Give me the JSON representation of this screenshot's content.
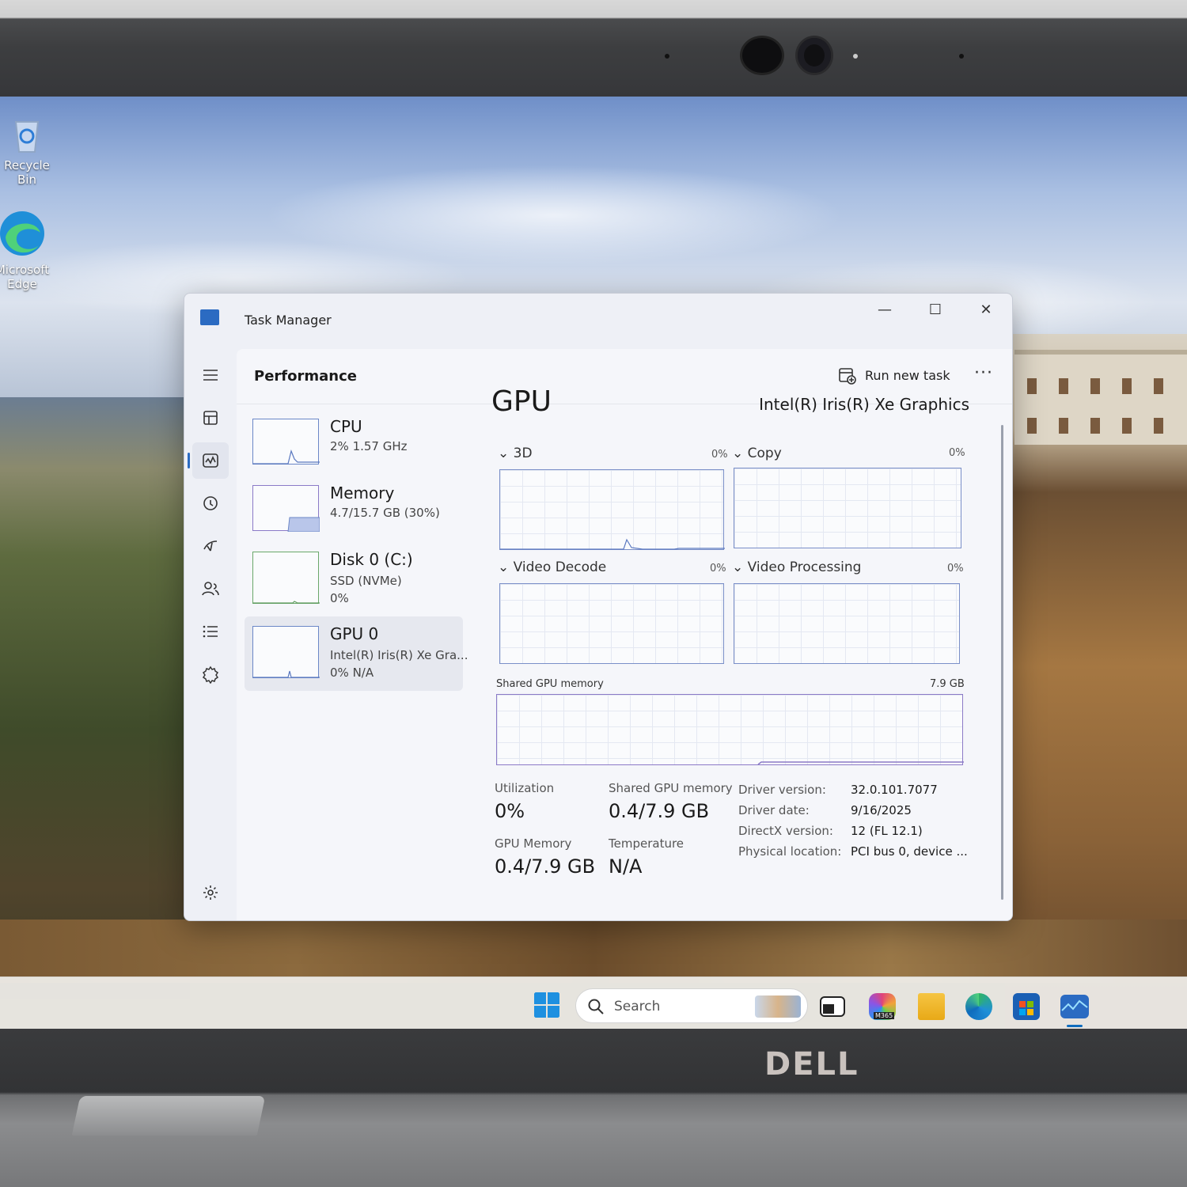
{
  "desktop": {
    "icons": [
      {
        "label": "Recycle Bin",
        "icon": "recycle-bin-icon"
      },
      {
        "label": "Microsoft Edge",
        "icon": "edge-icon"
      }
    ]
  },
  "bezel": {
    "brand": "DELL"
  },
  "taskbar": {
    "search_placeholder": "Search",
    "apps": [
      "start-icon",
      "search-icon",
      "task-view-icon",
      "m365-icon",
      "file-explorer-icon",
      "edge-icon",
      "store-icon",
      "task-manager-icon"
    ],
    "m365_badge": "M365"
  },
  "window": {
    "title": "Task Manager",
    "controls": {
      "minimize": "—",
      "maximize": "☐",
      "close": "✕"
    }
  },
  "nav": {
    "items": [
      "menu-icon",
      "processes-icon",
      "performance-icon",
      "app-history-icon",
      "startup-apps-icon",
      "users-icon",
      "details-icon",
      "services-icon",
      "settings-icon"
    ],
    "active": "performance-icon"
  },
  "header": {
    "title": "Performance",
    "run_new_task": "Run new task",
    "more": "···"
  },
  "devices": [
    {
      "name": "CPU",
      "line1": "2%  1.57 GHz",
      "line2": ""
    },
    {
      "name": "Memory",
      "line1": "4.7/15.7 GB (30%)",
      "line2": ""
    },
    {
      "name": "Disk 0 (C:)",
      "line1": "SSD (NVMe)",
      "line2": "0%"
    },
    {
      "name": "GPU 0",
      "line1": "Intel(R) Iris(R) Xe Gra...",
      "line2": "0%  N/A"
    }
  ],
  "gpu": {
    "title": "GPU",
    "model": "Intel(R) Iris(R) Xe Graphics",
    "engines": [
      {
        "label": "3D",
        "pct": "0%"
      },
      {
        "label": "Copy",
        "pct": "0%"
      },
      {
        "label": "Video Decode",
        "pct": "0%"
      },
      {
        "label": "Video Processing",
        "pct": "0%"
      }
    ],
    "shared_memory_label": "Shared GPU memory",
    "shared_memory_max": "7.9 GB",
    "stats": {
      "utilization_label": "Utilization",
      "utilization": "0%",
      "shared_label": "Shared GPU memory",
      "shared": "0.4/7.9 GB",
      "gpu_mem_label": "GPU Memory",
      "gpu_mem": "0.4/7.9 GB",
      "temp_label": "Temperature",
      "temp": "N/A"
    },
    "info": [
      {
        "key": "Driver version:",
        "value": "32.0.101.7077"
      },
      {
        "key": "Driver date:",
        "value": "9/16/2025"
      },
      {
        "key": "DirectX version:",
        "value": "12 (FL 12.1)"
      },
      {
        "key": "Physical location:",
        "value": "PCI bus 0, device ..."
      }
    ]
  },
  "colors": {
    "accent": "#2b6bc2",
    "graph_border": "#7a8fc8",
    "window_bg": "#eef0f6"
  }
}
